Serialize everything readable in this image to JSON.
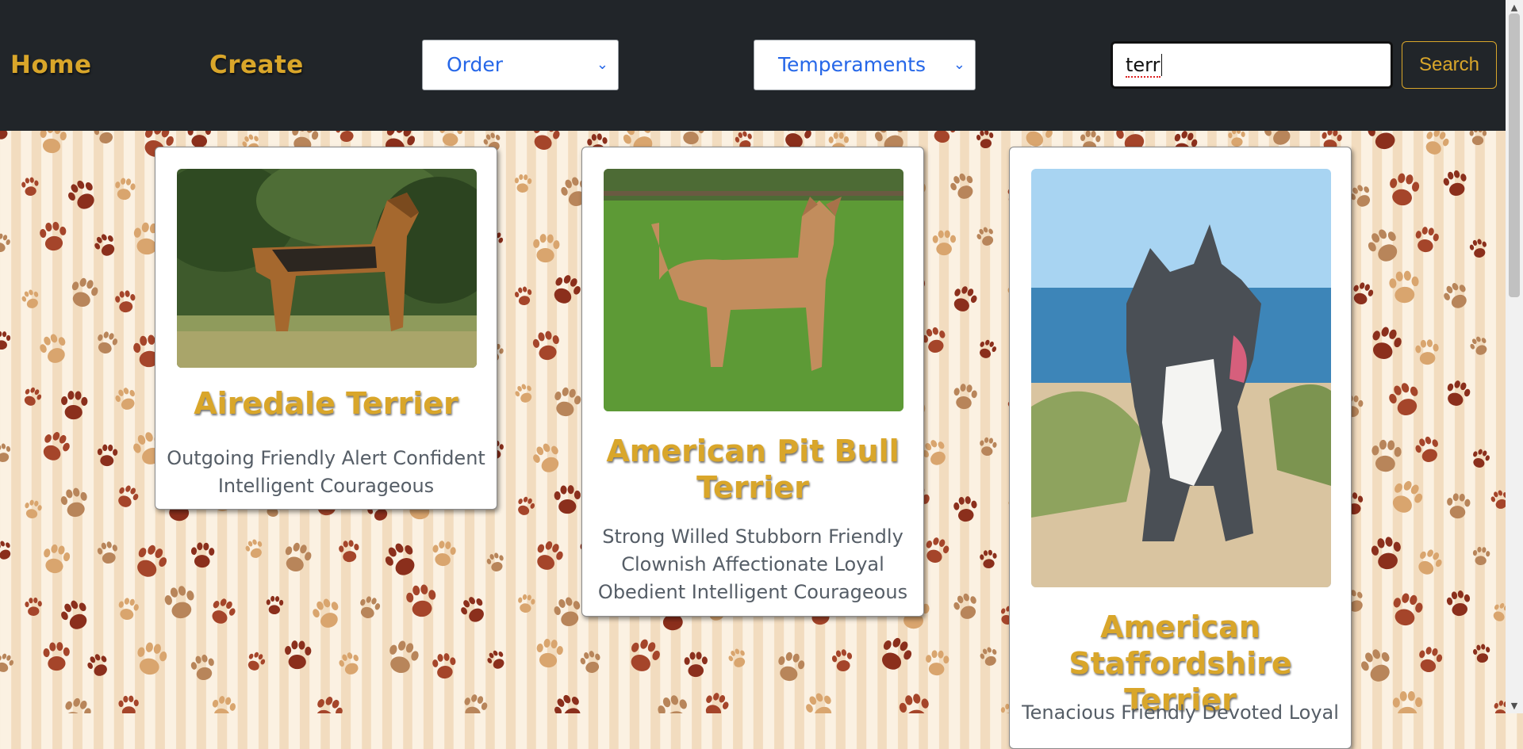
{
  "navbar": {
    "home_label": "Home",
    "create_label": "Create",
    "order_select": {
      "selected": "Order"
    },
    "temperament_select": {
      "selected": "Temperaments"
    },
    "search": {
      "value": "terr"
    },
    "search_button_label": "Search"
  },
  "cards": [
    {
      "name": "Airedale Terrier",
      "temperament": "Outgoing Friendly Alert Confident Intelligent Courageous"
    },
    {
      "name": "American Pit Bull Terrier",
      "temperament": "Strong Willed Stubborn Friendly Clownish Affectionate Loyal Obedient Intelligent Courageous"
    },
    {
      "name": "American Staffordshire Terrier",
      "temperament": "Tenacious Friendly Devoted Loyal"
    }
  ],
  "colors": {
    "navbar_bg": "#212529",
    "brand_gold": "#d9a62a",
    "select_text": "#2667e8",
    "paw_dark": "#8b2f1c",
    "paw_light": "#d9a56e"
  },
  "icons": {
    "select_chevron": "chevron-down-icon",
    "background_pattern": "paw-print-icon"
  }
}
